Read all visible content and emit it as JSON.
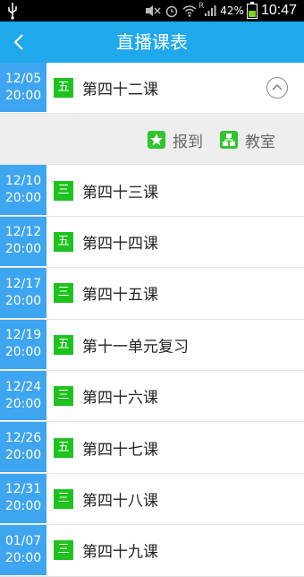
{
  "status": {
    "battery": "42%",
    "time": "10:47",
    "signal_label": "R"
  },
  "header": {
    "title": "直播课表",
    "back_icon": "chevron-left-icon"
  },
  "expanded_actions": [
    {
      "label": "报到",
      "icon": "star-icon"
    },
    {
      "label": "教室",
      "icon": "classroom-icon"
    }
  ],
  "colors": {
    "title_bg": "#1fa8ec",
    "date_bg": "#3ea5f0",
    "day_badge": "#1ec21e"
  },
  "lessons": [
    {
      "date": "12/05",
      "time": "20:00",
      "day": "五",
      "title": "第四十二课",
      "expanded": true
    },
    {
      "date": "12/10",
      "time": "20:00",
      "day": "三",
      "title": "第四十三课"
    },
    {
      "date": "12/12",
      "time": "20:00",
      "day": "五",
      "title": "第四十四课"
    },
    {
      "date": "12/17",
      "time": "20:00",
      "day": "三",
      "title": "第四十五课"
    },
    {
      "date": "12/19",
      "time": "20:00",
      "day": "五",
      "title": "第十一单元复习"
    },
    {
      "date": "12/24",
      "time": "20:00",
      "day": "三",
      "title": "第四十六课"
    },
    {
      "date": "12/26",
      "time": "20:00",
      "day": "五",
      "title": "第四十七课"
    },
    {
      "date": "12/31",
      "time": "20:00",
      "day": "三",
      "title": "第四十八课"
    },
    {
      "date": "01/07",
      "time": "20:00",
      "day": "三",
      "title": "第四十九课"
    }
  ]
}
